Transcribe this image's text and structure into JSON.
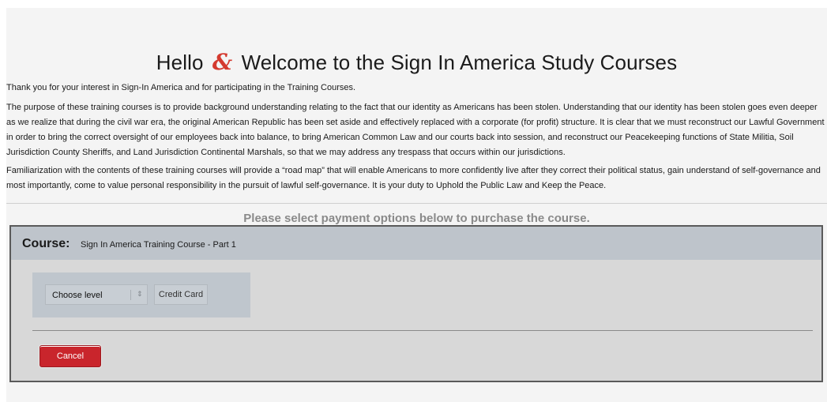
{
  "header": {
    "title_before": "Hello",
    "ampersand": "&",
    "title_after": "Welcome to the Sign In America Study Courses"
  },
  "intro": {
    "thanks": "Thank you for your interest in Sign-In America and for participating in the Training Courses.",
    "purpose": "The purpose of these training courses is to provide background understanding relating to the fact that our identity as Americans has been stolen. Understanding that our identity has been stolen goes even deeper as we realize that during the civil war era, the original American Republic has been set aside and effectively replaced with a corporate (for profit) structure. It is clear that we must reconstruct our Lawful Government in order to bring the correct oversight of our employees back into balance, to bring American Common Law and our courts back into session, and reconstruct our Peacekeeping functions of State Militia, Soil Jurisdiction County Sheriffs, and Land Jurisdiction Continental Marshals, so that we may address any trespass that occurs within our jurisdictions.",
    "familiarization": "Familiarization with the contents of these training courses will provide a “road map” that will enable Americans to more confidently live after they correct their political status, gain understand of self-governance and most importantly, come to value personal responsibility in the pursuit of lawful self-governance. It is your duty to Uphold the Public Law and Keep the Peace."
  },
  "payment_note": "Please select payment options below to purchase the course.",
  "course": {
    "label": "Course:",
    "name": "Sign In America Training Course - Part 1"
  },
  "options": {
    "level_select": "Choose level",
    "level_arrows": "⇕",
    "credit_card": "Credit Card"
  },
  "actions": {
    "cancel": "Cancel"
  },
  "colors": {
    "accent_ampersand": "#d43a2f",
    "cancel_button": "#c9252c",
    "course_header": "#bec4cb"
  }
}
